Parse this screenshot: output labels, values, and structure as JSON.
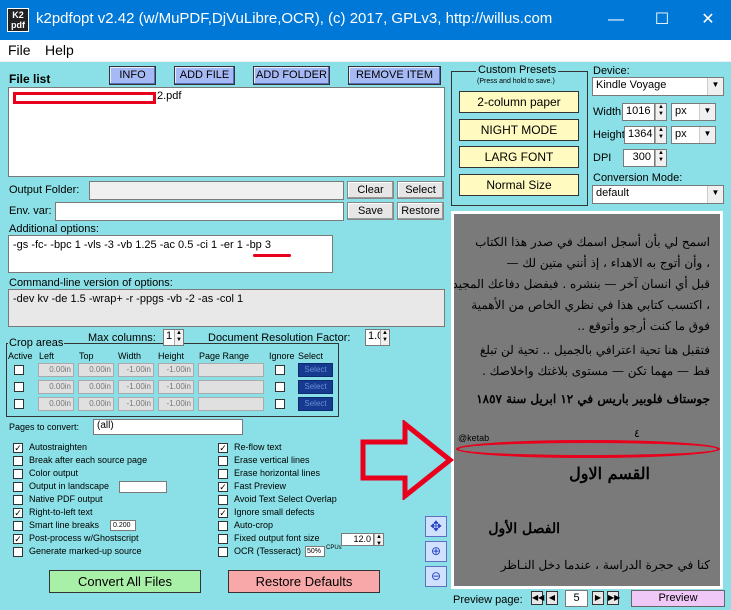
{
  "window": {
    "icon_text": "K2\npdf",
    "title": "k2pdfopt v2.42 (w/MuPDF,DjVuLibre,OCR), (c) 2017, GPLv3, http://willus.com",
    "controls": {
      "minimize": "—",
      "maximize": "☐",
      "close": "✕"
    }
  },
  "menu": {
    "file": "File",
    "help": "Help"
  },
  "file_list": {
    "label": "File list",
    "item_suffix": "2.pdf",
    "buttons": {
      "info": "INFO",
      "add_file": "ADD FILE",
      "add_folder": "ADD FOLDER",
      "remove_item": "REMOVE ITEM"
    }
  },
  "output_folder": {
    "label": "Output Folder:",
    "value": "",
    "clear": "Clear",
    "select": "Select"
  },
  "env_var": {
    "label": "Env. var:",
    "value": "",
    "save": "Save",
    "restore": "Restore"
  },
  "additional_options": {
    "label": "Additional options:",
    "value": "-gs -fc- -bpc 1 -vls -3 -vb 1.25 -ac 0.5 -ci 1 -er 1 -bp 3"
  },
  "command_line": {
    "label": "Command-line version of options:",
    "value": "-dev kv -de 1.5 -wrap+ -r -ppgs -vb -2 -as -col 1"
  },
  "crop_areas": {
    "label": "Crop areas",
    "headers": {
      "active": "Active",
      "left": "Left",
      "top": "Top",
      "width": "Width",
      "height": "Height",
      "page_range": "Page Range",
      "ignore": "Ignore",
      "select": "Select"
    },
    "rows": [
      {
        "left": "0.00in",
        "top": "0.00in",
        "width": "-1.00in",
        "height": "-1.00in",
        "select": "Select"
      },
      {
        "left": "0.00in",
        "top": "0.00in",
        "width": "-1.00in",
        "height": "-1.00in",
        "select": "Select"
      },
      {
        "left": "0.00in",
        "top": "0.00in",
        "width": "-1.00in",
        "height": "-1.00in",
        "select": "Select"
      }
    ]
  },
  "max_columns": {
    "label": "Max columns:",
    "value": "1"
  },
  "doc_res": {
    "label": "Document Resolution Factor:",
    "value": "1.0"
  },
  "pages_to_convert": {
    "label": "Pages to convert:",
    "value": "(all)"
  },
  "options_left": [
    {
      "label": "Autostraighten",
      "checked": true
    },
    {
      "label": "Break after each source page",
      "checked": false
    },
    {
      "label": "Color output",
      "checked": false
    },
    {
      "label": "Output in landscape",
      "checked": false
    },
    {
      "label": "Native PDF output",
      "checked": false
    },
    {
      "label": "Right-to-left text",
      "checked": true
    },
    {
      "label": "Smart line breaks",
      "checked": false,
      "extra": "0.200"
    },
    {
      "label": "Post-process w/Ghostscript",
      "checked": true
    },
    {
      "label": "Generate marked-up source",
      "checked": false
    }
  ],
  "options_right": [
    {
      "label": "Re-flow text",
      "checked": true
    },
    {
      "label": "Erase vertical lines",
      "checked": false
    },
    {
      "label": "Erase horizontal lines",
      "checked": false
    },
    {
      "label": "Fast Preview",
      "checked": true
    },
    {
      "label": "Avoid Text Select Overlap",
      "checked": false
    },
    {
      "label": "Ignore small defects",
      "checked": true
    },
    {
      "label": "Auto-crop",
      "checked": false
    },
    {
      "label": "Fixed output font size",
      "checked": false,
      "extra": "12.0"
    },
    {
      "label": "OCR (Tesseract)",
      "checked": false,
      "extra": "50%",
      "extra2": "CPUs"
    }
  ],
  "convert_button": "Convert All Files",
  "restore_defaults_button": "Restore Defaults",
  "presets": {
    "title": "Custom Presets",
    "subtitle": "(Press and hold to save.)",
    "items": [
      "2-column paper",
      "NIGHT MODE",
      "LARG FONT",
      "Normal Size"
    ]
  },
  "device": {
    "label": "Device:",
    "value": "Kindle Voyage",
    "width_label": "Width",
    "width_value": "1016",
    "width_unit": "px",
    "height_label": "Height",
    "height_value": "1364",
    "height_unit": "px",
    "dpi_label": "DPI",
    "dpi_value": "300",
    "conv_label": "Conversion Mode:",
    "conv_value": "default"
  },
  "preview_text": {
    "l1": "اسمح لي بأن أسجل اسمك في صدر هذا الكتاب",
    "l2": "، وأن أتوج به الاهداء ، إذ أنني متين لك —",
    "l3": "قبل أي انسان آخر — بنشره . فبفضل دفاعك المجيد",
    "l4": "، اكتسب كتابي هذا في نظري الخاص من الأهمية",
    "l5": "فوق ما كنت أرجو وأتوقع ..",
    "l6": "فتقبل هنا تحية اعترافي بالجميل .. تحية لن تبلغ",
    "l7": "قط — مهما تكن — مستوى بلاغتك واخلاصك .",
    "l8": "جوستاف فلوبير باريس في ١٢ ابريل سنة ١٨٥٧",
    "l9": "٤",
    "l10": "القسم الاول",
    "l11": "الفصل الأول",
    "l12": "كنا في حجرة الدراسة ، عندما دخل النـاظر",
    "watermark": "@ketab"
  },
  "preview_nav": {
    "label": "Preview page:",
    "first": "◀◀",
    "prev": "◀",
    "page": "5",
    "next": "▶",
    "last": "▶▶",
    "preview": "Preview"
  },
  "annotation_colors": {
    "red": "#e8001c"
  }
}
